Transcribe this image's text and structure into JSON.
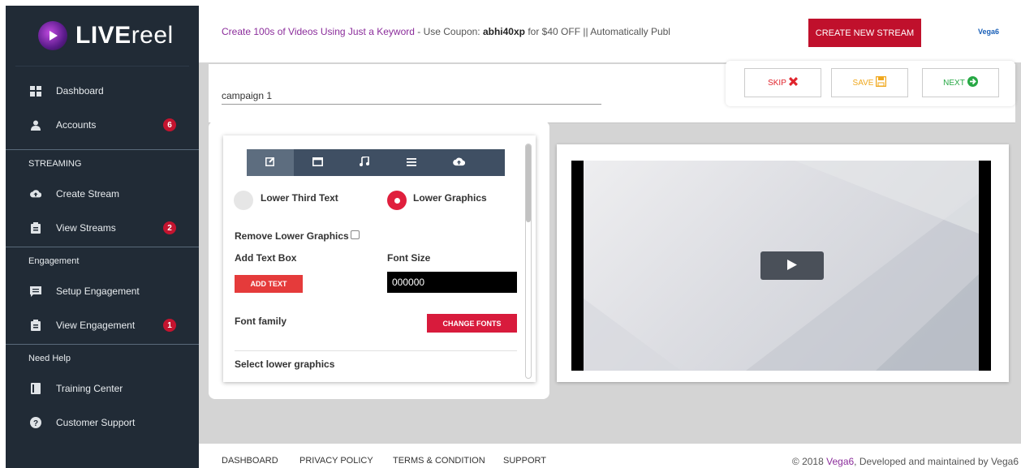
{
  "brand": {
    "logo_bold": "LIVE",
    "logo_light": "reel"
  },
  "sidebar": {
    "items": [
      {
        "label": "Dashboard",
        "icon": "dashboard-icon"
      },
      {
        "label": "Accounts",
        "icon": "user-icon",
        "badge": "6"
      }
    ],
    "sections": [
      {
        "title": "STREAMING",
        "items": [
          {
            "label": "Create Stream",
            "icon": "cloud-upload-icon"
          },
          {
            "label": "View Streams",
            "icon": "clipboard-icon",
            "badge": "2"
          }
        ]
      },
      {
        "title": "Engagement",
        "items": [
          {
            "label": "Setup Engagement",
            "icon": "comment-icon"
          },
          {
            "label": "View Engagement",
            "icon": "clipboard-icon",
            "badge": "1"
          }
        ]
      },
      {
        "title": "Need Help",
        "items": [
          {
            "label": "Training Center",
            "icon": "book-icon"
          },
          {
            "label": "Customer Support",
            "icon": "help-icon"
          }
        ]
      }
    ]
  },
  "header": {
    "promo_pre": "Create 100s of Videos Using Just a Keyword",
    "promo_mid": " - Use Coupon: ",
    "promo_code": "abhi40xp",
    "promo_post": " for $40 OFF || Automatically Publ",
    "create_button": "CREATE NEW STREAM",
    "vega_logo": "Vega6"
  },
  "campaign": {
    "name": "campaign 1"
  },
  "actions": {
    "skip": "SKIP",
    "save": "SAVE",
    "next": "NEXT"
  },
  "editor": {
    "tabs": [
      "edit-icon",
      "window-icon",
      "music-icon",
      "menu-icon",
      "cloud-upload-icon"
    ],
    "radio_lower_third": "Lower Third Text",
    "radio_lower_graphics": "Lower Graphics",
    "remove_lower_graphics": "Remove Lower Graphics",
    "add_text_box": "Add Text Box",
    "font_size": "Font Size",
    "add_text_button": "ADD TEXT",
    "font_color_value": "000000",
    "font_family": "Font family",
    "change_fonts_button": "CHANGE FONTS",
    "select_lower_graphics": "Select lower graphics"
  },
  "footer": {
    "links": [
      "DASHBOARD",
      "PRIVACY POLICY",
      "TERMS & CONDITION",
      "SUPPORT"
    ],
    "copy_pre": "© 2018 ",
    "copy_link": "Vega6",
    "copy_post": ", Developed and maintained by Vega6"
  },
  "colors": {
    "sidebar_bg": "#212b36",
    "accent_red": "#c0102c",
    "promo_purple": "#8b2d9b",
    "tab_bg": "#3f4f63"
  }
}
